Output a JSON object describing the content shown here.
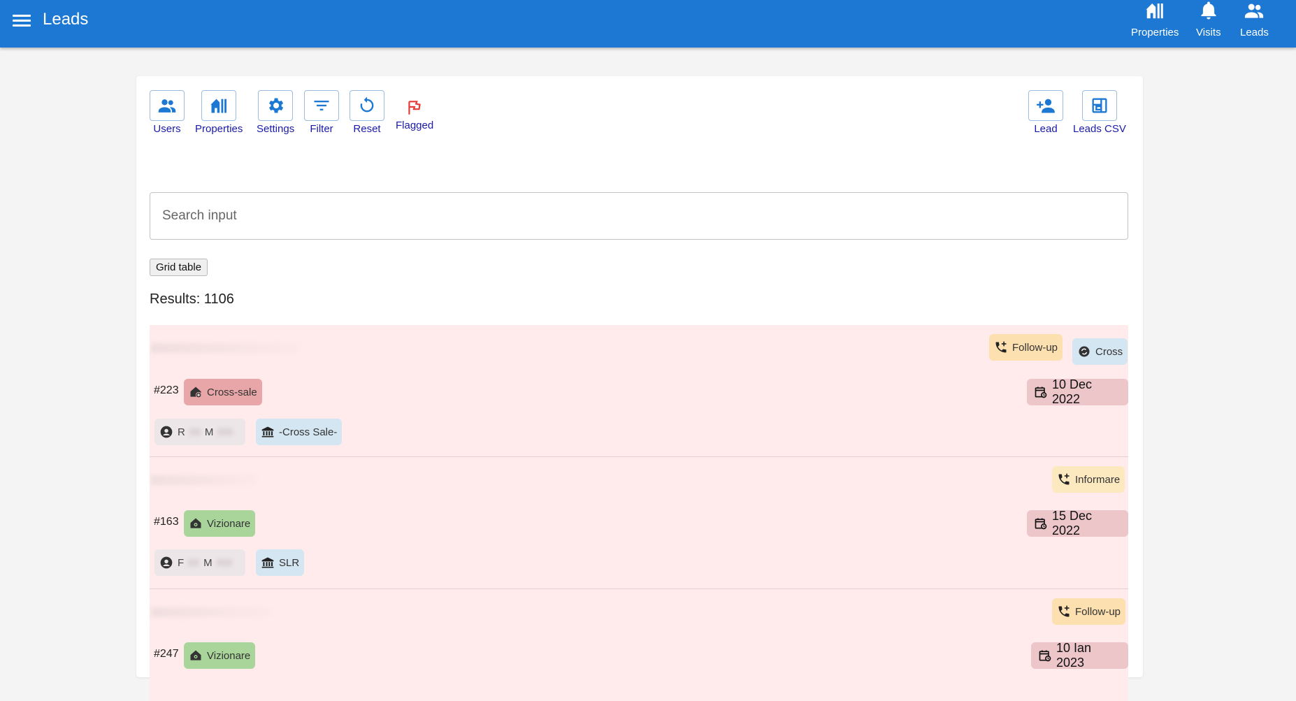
{
  "header": {
    "title": "Leads",
    "nav": [
      {
        "label": "Properties",
        "icon": "properties-icon"
      },
      {
        "label": "Visits",
        "icon": "bell-icon"
      },
      {
        "label": "Leads",
        "icon": "people-icon"
      }
    ]
  },
  "toolbar": {
    "users": "Users",
    "properties": "Properties",
    "settings": "Settings",
    "filter": "Filter",
    "reset": "Reset",
    "flagged": "Flagged",
    "lead": "Lead",
    "leads_csv": "Leads CSV"
  },
  "search": {
    "placeholder": "Search input",
    "value": ""
  },
  "grid_button": "Grid table",
  "results": "Results: 1106",
  "leads": [
    {
      "id": "#223",
      "status": "Cross-sale",
      "status_icon": "house-plus-icon",
      "tags": [
        {
          "label": "Follow-up",
          "icon": "phone-plus-icon"
        },
        {
          "label": "Cross",
          "icon": "sync-icon"
        }
      ],
      "date": "10 Dec 2022",
      "agent_initial": "R",
      "agent_second": "M",
      "source": "-Cross Sale-"
    },
    {
      "id": "#163",
      "status": "Vizionare",
      "status_icon": "house-visit-icon",
      "tags": [
        {
          "label": "Informare",
          "icon": "phone-plus-icon"
        }
      ],
      "date": "15 Dec 2022",
      "agent_initial": "F",
      "agent_second": "M",
      "source": "SLR"
    },
    {
      "id": "#247",
      "status": "Vizionare",
      "status_icon": "house-visit-icon",
      "tags": [
        {
          "label": "Follow-up",
          "icon": "phone-plus-icon"
        }
      ],
      "date": "10 Ian 2023"
    }
  ],
  "colors": {
    "header": "#1c78d2",
    "link": "#1a1aa8",
    "lead_bg": "#ffebeb",
    "flag": "#e53935"
  }
}
